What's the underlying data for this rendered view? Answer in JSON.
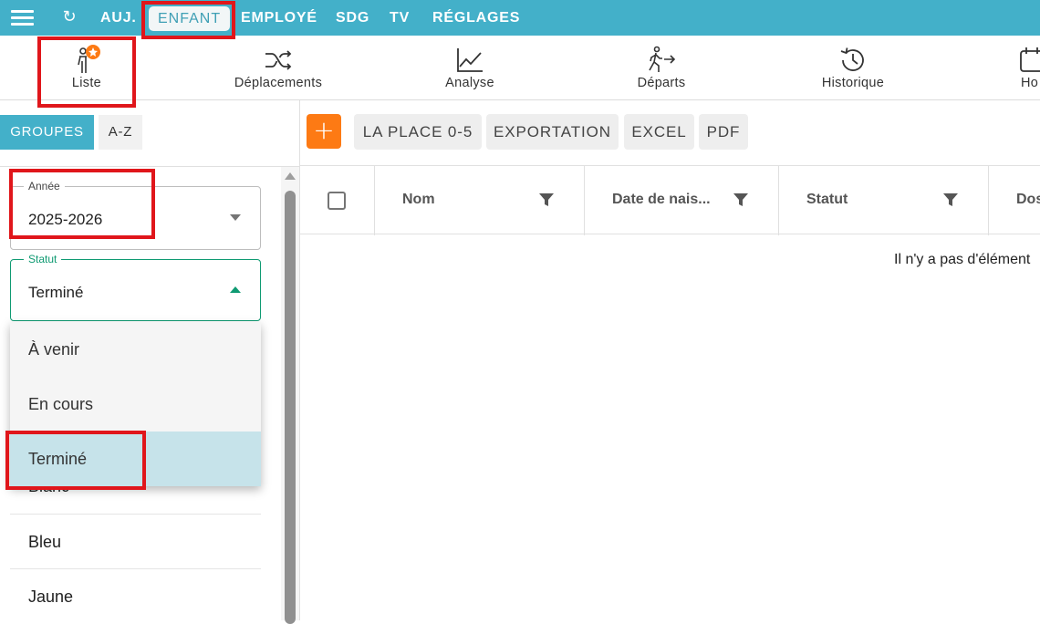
{
  "topbar": {
    "items": [
      "AUJ.",
      "ENFANT",
      "EMPLOYÉ",
      "SDG",
      "TV",
      "RÉGLAGES"
    ],
    "active": "ENFANT",
    "color": "#43b0c9"
  },
  "subnav": {
    "items": [
      {
        "label": "Liste",
        "icon": "child-star-icon"
      },
      {
        "label": "Déplacements",
        "icon": "shuffle-icon"
      },
      {
        "label": "Analyse",
        "icon": "line-chart-icon"
      },
      {
        "label": "Départs",
        "icon": "walking-exit-icon"
      },
      {
        "label": "Historique",
        "icon": "history-icon"
      },
      {
        "label": "Ho",
        "icon": "calendar-icon"
      }
    ]
  },
  "left": {
    "tabs": {
      "groupes": "GROUPES",
      "az": "A-Z"
    },
    "year": {
      "legend": "Année",
      "value": "2025-2026"
    },
    "statut": {
      "legend": "Statut",
      "value": "Terminé"
    },
    "dropdown": [
      "À venir",
      "En cours",
      "Terminé"
    ],
    "groups": [
      "Blanc",
      "Bleu",
      "Jaune"
    ]
  },
  "toolbar": {
    "add": "+",
    "buttons": [
      "LA PLACE 0-5",
      "EXPORTATION",
      "EXCEL",
      "PDF"
    ],
    "add_color": "#fd7a14"
  },
  "table": {
    "columns": [
      "Nom",
      "Date de nais...",
      "Statut",
      "Dos"
    ],
    "empty": "Il n'y a pas d'élément"
  }
}
